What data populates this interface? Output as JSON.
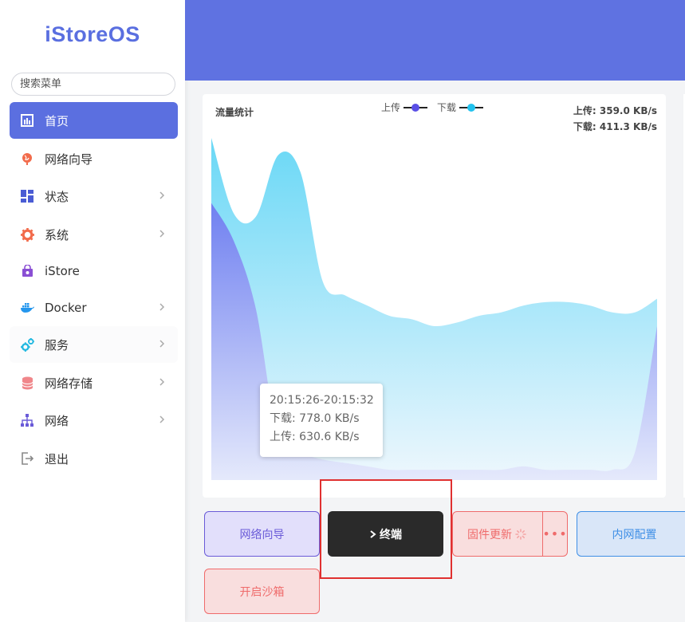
{
  "app": {
    "logo": "iStoreOS"
  },
  "sidebar": {
    "search_placeholder": "搜索菜单",
    "items": [
      {
        "label": "首页",
        "icon": "dashboard-icon",
        "active": true
      },
      {
        "label": "网络向导",
        "icon": "globe-icon"
      },
      {
        "label": "状态",
        "icon": "grid-icon",
        "has_children": true
      },
      {
        "label": "系统",
        "icon": "gear-icon",
        "has_children": true
      },
      {
        "label": "iStore",
        "icon": "shopping-bag-icon"
      },
      {
        "label": "Docker",
        "icon": "docker-whale-icon",
        "has_children": true
      },
      {
        "label": "服务",
        "icon": "cogs-icon",
        "has_children": true
      },
      {
        "label": "网络存储",
        "icon": "database-icon",
        "has_children": true
      },
      {
        "label": "网络",
        "icon": "network-tree-icon",
        "has_children": true
      },
      {
        "label": "退出",
        "icon": "logout-icon"
      }
    ]
  },
  "traffic": {
    "title": "流量统计",
    "legend": [
      {
        "name": "上传",
        "color": "#5a4fe6"
      },
      {
        "name": "下载",
        "color": "#22c2ee"
      }
    ],
    "upload_rate": "上传: 359.0 KB/s",
    "download_rate": "下载: 411.3 KB/s",
    "tooltip": {
      "time": "20:15:26-20:15:32",
      "download": "下载: 778.0 KB/s",
      "upload": "上传: 630.6 KB/s"
    }
  },
  "chart_data": {
    "type": "area",
    "x": [
      0,
      1,
      2,
      3,
      4,
      5,
      6,
      7,
      8,
      9,
      10,
      11,
      12,
      13,
      14,
      15,
      16,
      17,
      18,
      19,
      20
    ],
    "series": [
      {
        "name": "下载",
        "color": "#22c2ee",
        "values": [
          100,
          78,
          77,
          95,
          90,
          58,
          54,
          51,
          48,
          47,
          45,
          46,
          48,
          49,
          51,
          52,
          52,
          51,
          49,
          49,
          53
        ]
      },
      {
        "name": "上传",
        "color": "#5a4fe6",
        "values": [
          81,
          70,
          50,
          12,
          8,
          6,
          5,
          4,
          3,
          3,
          3,
          3,
          3,
          3,
          4,
          3,
          3,
          3,
          3,
          8,
          45
        ]
      }
    ],
    "ylim": [
      0,
      100
    ],
    "grid": false,
    "legend_position": "top-center"
  },
  "actions": {
    "wizard": "网络向导",
    "terminal": "终端",
    "firmware": "固件更新",
    "more": "•••",
    "lan": "内网配置",
    "sandbox": "开启沙箱"
  },
  "colors": {
    "accent": "#5f72e1",
    "active_menu": "#5b6fe0",
    "terminal_bg": "#2a2a2a",
    "danger": "#ef6b6b",
    "info": "#3f8fe6"
  }
}
